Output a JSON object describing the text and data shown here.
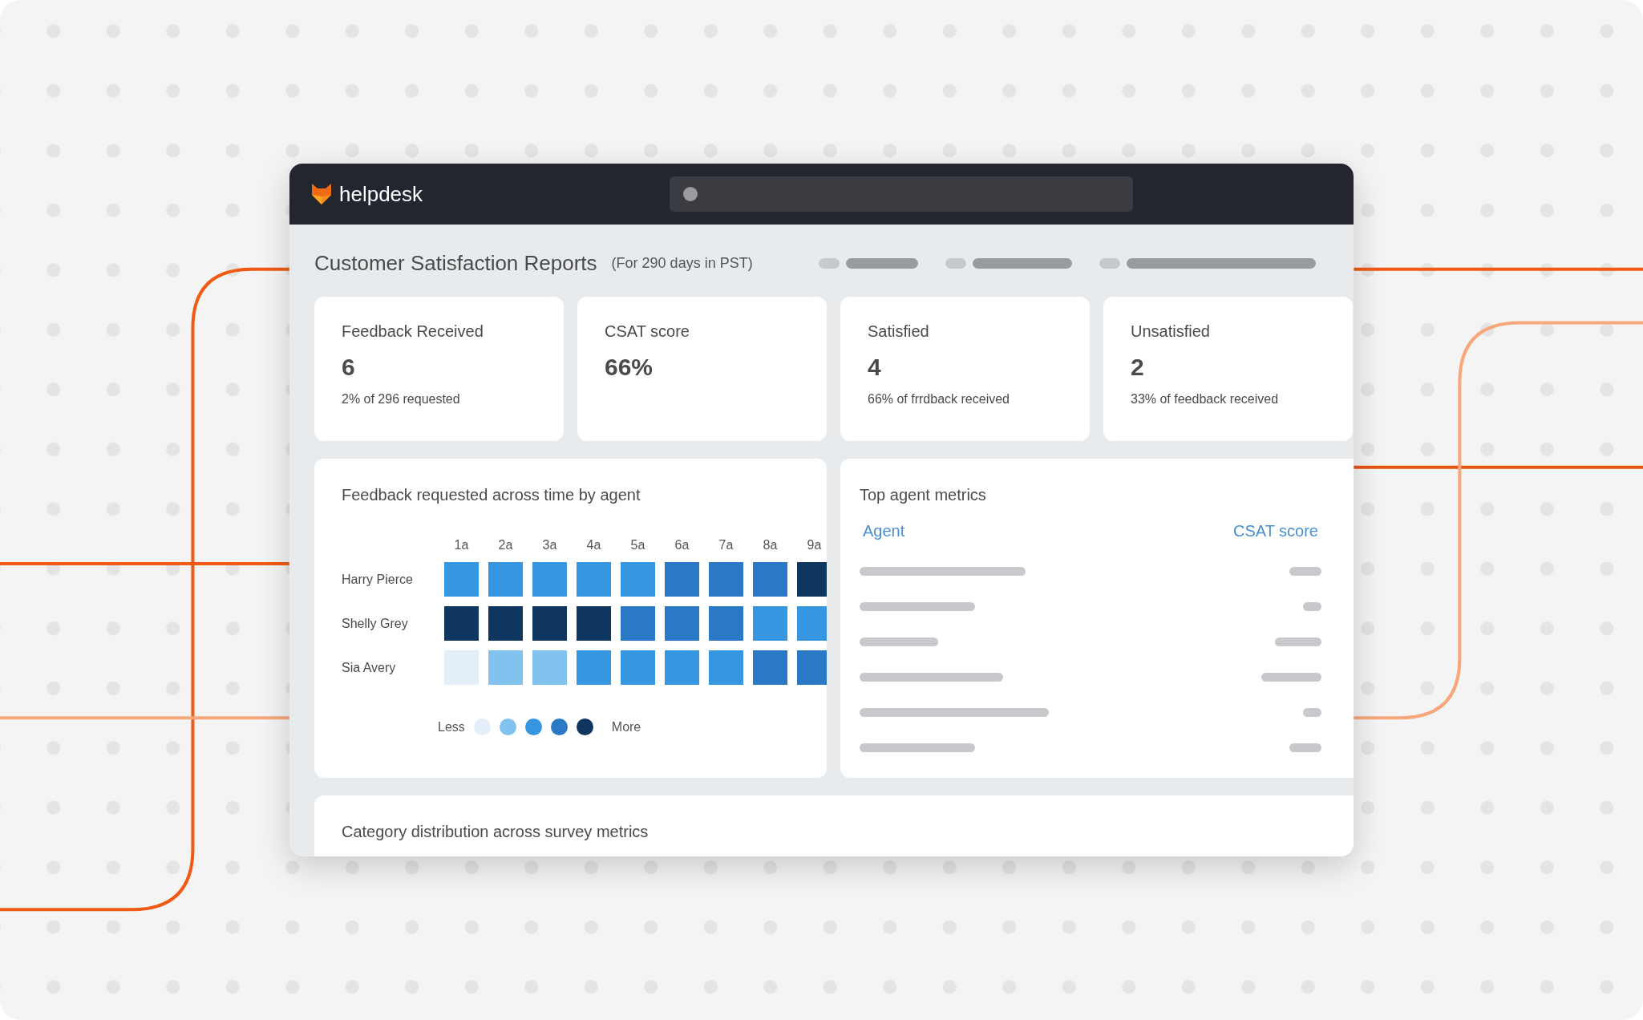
{
  "app": {
    "name": "helpdesk"
  },
  "report": {
    "title": "Customer Satisfaction Reports",
    "period": "(For 290 days in PST)"
  },
  "stats": [
    {
      "label": "Feedback Received",
      "value": "6",
      "note": "2% of 296 requested"
    },
    {
      "label": "CSAT score",
      "value": "66%"
    },
    {
      "label": "Satisfied",
      "value": "4",
      "note": "66% of frrdback received"
    },
    {
      "label": "Unsatisfied",
      "value": "2",
      "note": "33% of feedback received"
    }
  ],
  "heatmap": {
    "title": "Feedback requested across time by agent",
    "hours": [
      "1a",
      "2a",
      "3a",
      "4a",
      "5a",
      "6a",
      "7a",
      "8a",
      "9a"
    ],
    "rows": [
      {
        "agent": "Harry Pierce",
        "cells": [
          {
            "color": "#3796e0"
          },
          {
            "color": "#3796e0"
          },
          {
            "color": "#3796e0"
          },
          {
            "color": "#3796e0"
          },
          {
            "color": "#3796e0"
          },
          {
            "color": "#2a79c4"
          },
          {
            "color": "#2a79c4"
          },
          {
            "color": "#2a79c4"
          },
          {
            "color": "#0f365f"
          }
        ]
      },
      {
        "agent": "Shelly Grey",
        "cells": [
          {
            "color": "#0f365f"
          },
          {
            "color": "#0f365f"
          },
          {
            "color": "#0f365f"
          },
          {
            "color": "#0f365f"
          },
          {
            "color": "#2a79c4"
          },
          {
            "color": "#2a79c4"
          },
          {
            "color": "#2a79c4"
          },
          {
            "color": "#3796e0"
          },
          {
            "color": "#3796e0"
          }
        ]
      },
      {
        "agent": "Sia Avery",
        "cells": [
          {
            "color": "#e3eef9"
          },
          {
            "color": "#83c1ef"
          },
          {
            "color": "#83c1ef"
          },
          {
            "color": "#3796e0"
          },
          {
            "color": "#3796e0"
          },
          {
            "color": "#3796e0"
          },
          {
            "color": "#3796e0"
          },
          {
            "color": "#2a79c4"
          },
          {
            "color": "#2a79c4"
          }
        ]
      }
    ],
    "legend": {
      "less": "Less",
      "more": "More",
      "scale": [
        {
          "color": "#e3eef9"
        },
        {
          "color": "#83c1ef"
        },
        {
          "color": "#3796e0"
        },
        {
          "color": "#2a79c4"
        },
        {
          "color": "#0f365f"
        }
      ]
    }
  },
  "agent_metrics": {
    "title": "Top agent metrics",
    "columns": [
      "Agent",
      "CSAT score"
    ]
  },
  "category": {
    "title": "Category distribution across survey metrics"
  }
}
